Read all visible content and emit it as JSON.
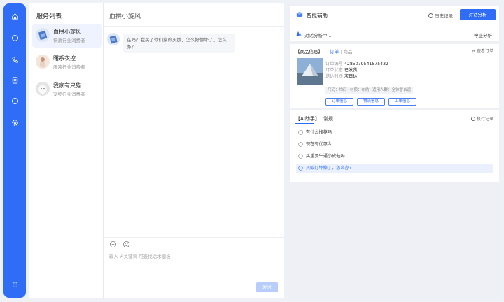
{
  "rail": {
    "icons": [
      "home-icon",
      "message-icon",
      "phone-icon",
      "clipboard-icon",
      "chart-icon",
      "settings-icon",
      "apps-icon"
    ]
  },
  "service_list": {
    "title": "服务列表",
    "items": [
      {
        "name": "血拼小旋风",
        "subtitle": "快消行业消费者",
        "active": true
      },
      {
        "name": "曙系衣控",
        "subtitle": "服装行业消费者",
        "active": false
      },
      {
        "name": "我家有只猫",
        "subtitle": "宠物行业消费者",
        "active": false
      }
    ]
  },
  "chat": {
    "title": "血拼小旋风",
    "message": "在吗？我买了你们家的灭蚊，怎么好像坏了，怎么办？",
    "input_placeholder": "输入 #关键词 可查找话术模板",
    "send_label": "发送"
  },
  "assistant": {
    "title": "智能辅助",
    "history_label": "历史记录",
    "dialog_analysis_label": "对话分析",
    "analyzing_text": "对话分析中...",
    "stop_label": "停止分析"
  },
  "order_card": {
    "header_left": "【商品信息】",
    "header_mid": "订单",
    "header_right": "商品",
    "view_all": "查看订单",
    "fields": [
      {
        "label": "订单编号",
        "value": "4285079541575432"
      },
      {
        "label": "订单状态",
        "value": "已发货"
      },
      {
        "label": "送达时间",
        "value": "次日达"
      }
    ],
    "tags": [
      "尺码：均码",
      "材质：布纺",
      "适用人群：全体智合适"
    ],
    "buttons": [
      "订单信息",
      "物流信息",
      "工单信息"
    ]
  },
  "ai_card": {
    "tab_ai": "【AI助手】",
    "tab_other": "常规",
    "exec_label": "执行记录",
    "suggestions": [
      "有什么推荐吗",
      "现在有优惠么",
      "买重复牛逼小皮鞋吗",
      "灭蚊灯坏掉了，怎么办？"
    ]
  },
  "colors": {
    "primary": "#2f6df6",
    "rail": "#2f6df6",
    "highlight_bg": "#eaf0fd"
  }
}
